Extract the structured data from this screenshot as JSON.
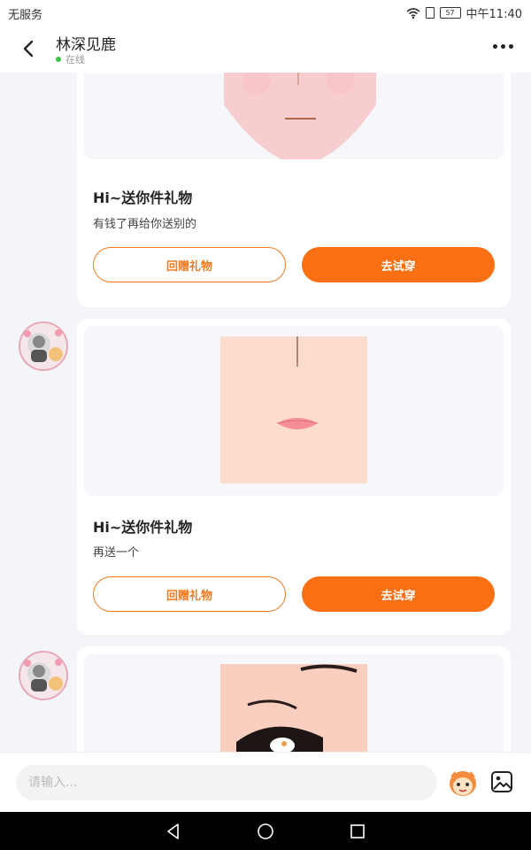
{
  "status_bar": {
    "carrier": "无服务",
    "battery": "57",
    "time": "中午11:40"
  },
  "header": {
    "title": "林深见鹿",
    "status": "在线"
  },
  "messages": [
    {
      "title": "Hi~送你件礼物",
      "text": "有钱了再给你送别的",
      "return_label": "回赠礼物",
      "try_label": "去试穿"
    },
    {
      "title": "Hi~送你件礼物",
      "text": "再送一个",
      "return_label": "回赠礼物",
      "try_label": "去试穿"
    }
  ],
  "input": {
    "placeholder": "请输入..."
  },
  "colors": {
    "accent": "#f96f14",
    "online": "#3ac24a",
    "background": "#f4f5f9"
  },
  "icons": [
    "back-arrow-icon",
    "more-icon",
    "emoji-icon",
    "image-icon",
    "nav-back-icon",
    "nav-home-icon",
    "nav-recent-icon"
  ]
}
